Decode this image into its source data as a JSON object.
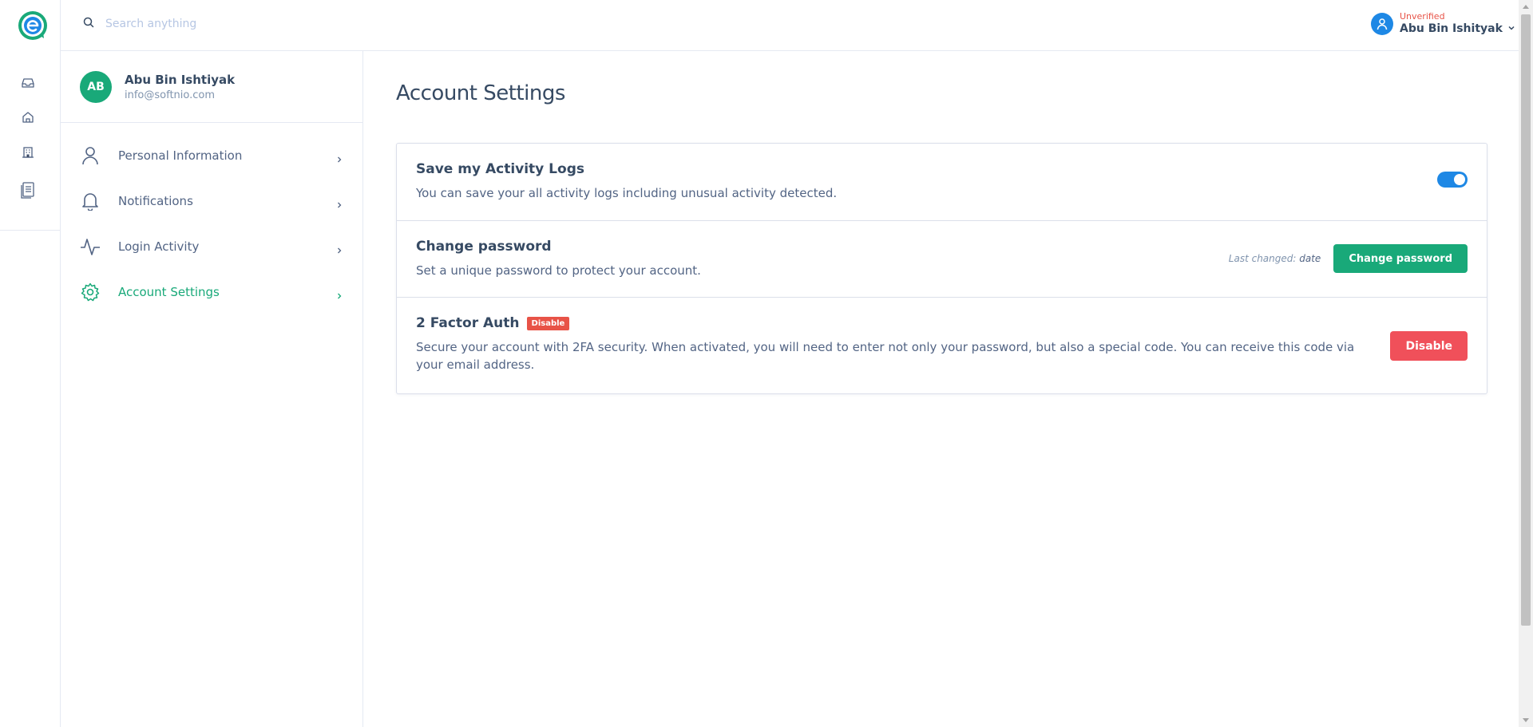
{
  "header": {
    "search_placeholder": "Search anything",
    "user_status": "Unverified",
    "user_name": "Abu Bin Ishityak"
  },
  "rail": {
    "icons": [
      "inbox-icon",
      "home-icon",
      "building-icon",
      "document-icon"
    ]
  },
  "profile": {
    "initials": "AB",
    "name": "Abu Bin Ishtiyak",
    "email": "info@softnio.com",
    "menu": [
      {
        "label": "Personal Information",
        "icon": "user-icon",
        "active": false
      },
      {
        "label": "Notifications",
        "icon": "bell-icon",
        "active": false
      },
      {
        "label": "Login Activity",
        "icon": "activity-icon",
        "active": false
      },
      {
        "label": "Account Settings",
        "icon": "gear-icon",
        "active": true
      }
    ]
  },
  "main": {
    "title": "Account Settings",
    "activity": {
      "title": "Save my Activity Logs",
      "desc": "You can save your all activity logs including unusual activity detected.",
      "enabled": true
    },
    "password": {
      "title": "Change password",
      "desc": "Set a unique password to protect your account.",
      "last_changed_label": "Last changed:",
      "last_changed_value": "date",
      "button": "Change password"
    },
    "twofa": {
      "title": "2 Factor Auth",
      "badge": "Disable",
      "desc": "Secure your account with 2FA security. When activated, you will need to enter not only your password, but also a special code. You can receive this code via your email address.",
      "button": "Disable"
    }
  },
  "colors": {
    "accent_green": "#19a979",
    "accent_blue": "#1e88e5",
    "danger": "#e85347"
  }
}
